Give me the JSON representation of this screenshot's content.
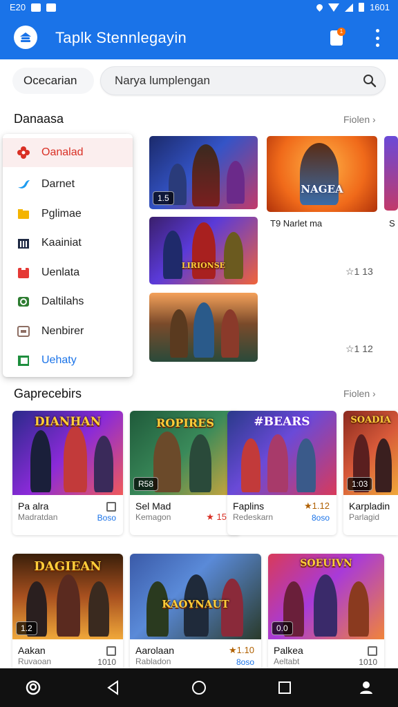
{
  "status_bar": {
    "left_text": "E20",
    "time": "1601"
  },
  "app_bar": {
    "title": "Taplk Stennlegayin",
    "notification_count": "1"
  },
  "search": {
    "label": "Ocecarian",
    "placeholder": "Narya lumplengan"
  },
  "section1": {
    "title": "Danaasa",
    "see_all": "Fiolen ›"
  },
  "dropdown": {
    "items": [
      {
        "label": "Oanalad",
        "icon": "flower-icon",
        "color": "#d93025"
      },
      {
        "label": "Darnet",
        "icon": "bird-icon",
        "color": "#1d9bf0"
      },
      {
        "label": "Pglimae",
        "icon": "folder-icon",
        "color": "#f4b400"
      },
      {
        "label": "Kaainiat",
        "icon": "grid-icon",
        "color": "#1f2a44"
      },
      {
        "label": "Uenlata",
        "icon": "youtube-icon",
        "color": "#e53935"
      },
      {
        "label": "Daltilahs",
        "icon": "chat-icon",
        "color": "#2e7d32"
      },
      {
        "label": "Nenbirer",
        "icon": "window-icon",
        "color": "#8d6e63"
      },
      {
        "label": "Uehaty",
        "icon": "flag-icon",
        "color": "#1e8e3e"
      }
    ]
  },
  "featured": {
    "cards": [
      {
        "badge": "1.5",
        "caption": ""
      },
      {
        "badge": "",
        "caption": "T9 Narlet ma",
        "logo": "NAGEA"
      },
      {
        "badge": "",
        "caption": "",
        "logo": "LIRIONSE"
      },
      {
        "badge": "",
        "caption": ""
      }
    ],
    "ratings": [
      "☆1 13",
      "☆1 12"
    ]
  },
  "section2": {
    "title": "Gaprecebirs",
    "see_all": "Fiolen ›"
  },
  "grid_row1": [
    {
      "name": "Pa alra",
      "sub": "Madratdan",
      "logo": "DIANHAN",
      "badge": "",
      "right1": "▢",
      "right2": "Boso"
    },
    {
      "name": "Sel Mad",
      "sub": "Kemagon",
      "logo": "ROPIRES",
      "badge": "R58",
      "right1": "",
      "right2": "",
      "rating": "★ 15"
    },
    {
      "name": "Faplins",
      "sub": "Redeskarn",
      "logo": "#BEARS",
      "badge": "",
      "right1": "★1.12",
      "right2": "8oso"
    },
    {
      "name": "Karpladin",
      "sub": "Parlagid",
      "logo": "SOADIA",
      "badge": "1:03",
      "right1": "",
      "right2": ""
    }
  ],
  "grid_row2": [
    {
      "name": "Aakan",
      "sub": "Ruvaoan",
      "logo": "DAGIEAN",
      "badge": "1.2",
      "right1": "▢",
      "right2": "1010"
    },
    {
      "name": "Aarolaan",
      "sub": "Rabladon",
      "logo": "KAOYNAUT",
      "badge": "",
      "right1": "★1.10",
      "right2": "8oso"
    },
    {
      "name": "Palkea",
      "sub": "Aeltabt",
      "logo": "SOEUIVN",
      "badge": "0.0",
      "right1": "▢",
      "right2": "1010"
    }
  ],
  "colors": {
    "primary": "#1a73e8",
    "accent_red": "#d93025",
    "nav": "#111111"
  }
}
